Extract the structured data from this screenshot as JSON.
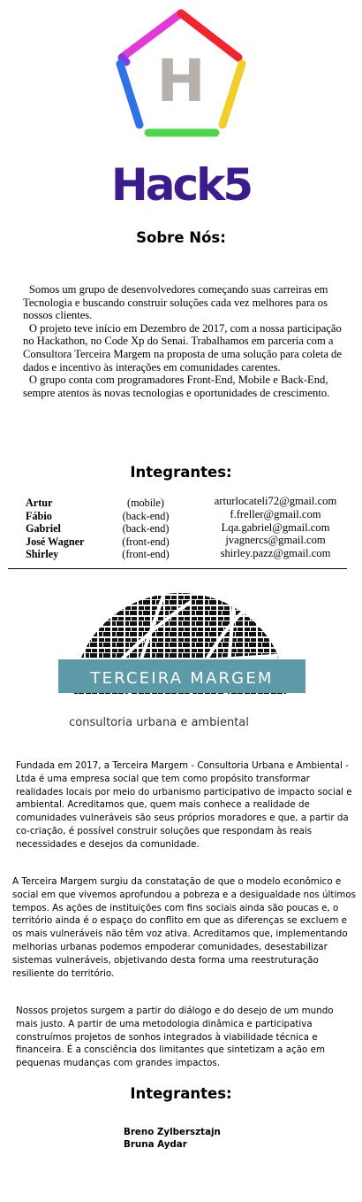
{
  "logo": {
    "letter": "H",
    "wordmark": "Hack5",
    "colors": [
      "#e13ad8",
      "#7b3fe4",
      "#f2252e",
      "#ee7a1e",
      "#f2ce2a",
      "#4fd64a",
      "#2f72e8"
    ],
    "letter_color": "#b7b0ab",
    "wordmark_color": "#3c1c8c"
  },
  "about": {
    "title": "Sobre Nós:",
    "paragraphs": [
      "Somos um grupo de desenvolvedores começando suas carreiras em Tecnologia e buscando construir soluções cada vez melhores para os nossos clientes.",
      "O projeto teve início em Dezembro de 2017, com a nossa participação no Hackathon, no Code Xp do Senai. Trabalhamos em parceria com a Consultora Terceira Margem na proposta de uma solução para coleta de dados e incentivo às interações em comunidades carentes.",
      "O grupo conta com programadores Front-End, Mobile e Back-End, sempre atentos às novas tecnologias e oportunidades de crescimento."
    ]
  },
  "team": {
    "title": "Integrantes:",
    "members": [
      {
        "name": "Artur",
        "role": "(mobile)",
        "email": "arturlocateli72@gmail.com"
      },
      {
        "name": "Fábio",
        "role": "(back-end)",
        "email": "f.freller@gmail.com"
      },
      {
        "name": "Gabriel",
        "role": "(back-end)",
        "email": "Lqa.gabriel@gmail.com"
      },
      {
        "name": "José Wagner",
        "role": "(front-end)",
        "email": "jvagnercs@gmail.com"
      },
      {
        "name": "Shirley",
        "role": "(front-end)",
        "email": "shirley.pazz@gmail.com"
      }
    ]
  },
  "partner": {
    "logo_name": "TERCEIRA MARGEM",
    "logo_subtitle": "consultoria urbana e ambiental",
    "banner_color": "#5b9aa6",
    "paragraphs": [
      "Fundada em 2017, a Terceira Margem - Consultoria Urbana e Ambiental - Ltda é uma empresa social que tem como propósito transformar realidades locais por meio do urbanismo participativo de impacto social e ambiental. Acreditamos que, quem mais conhece a realidade de comunidades vulneráveis são seus próprios moradores e que, a partir da co-criação, é possível construir soluções que respondam às reais necessidades e desejos da comunidade.",
      "A Terceira Margem surgiu da constatação de que o modelo econômico e social em que vivemos aprofundou a pobreza e a desigualdade nos últimos tempos. As ações de instituições com fins sociais ainda são poucas e, o território ainda é o espaço do conflito em que as diferenças se excluem e os mais vulneráveis não têm voz ativa. Acreditamos que, implementando melhorias urbanas podemos empoderar comunidades, desestabilizar sistemas vulneráveis, objetivando desta forma uma reestruturação resiliente do território.",
      "Nossos projetos surgem a partir do diálogo e do desejo de um mundo mais justo. A partir de uma metodologia dinâmica e participativa construímos projetos de sonhos integrados à viabilidade técnica e financeira. É a consciência dos limitantes que sintetizam a ação em pequenas mudanças com grandes impactos."
    ],
    "team_title": "Integrantes:",
    "members": [
      "Breno Zylbersztajn",
      "Bruna Aydar"
    ]
  }
}
